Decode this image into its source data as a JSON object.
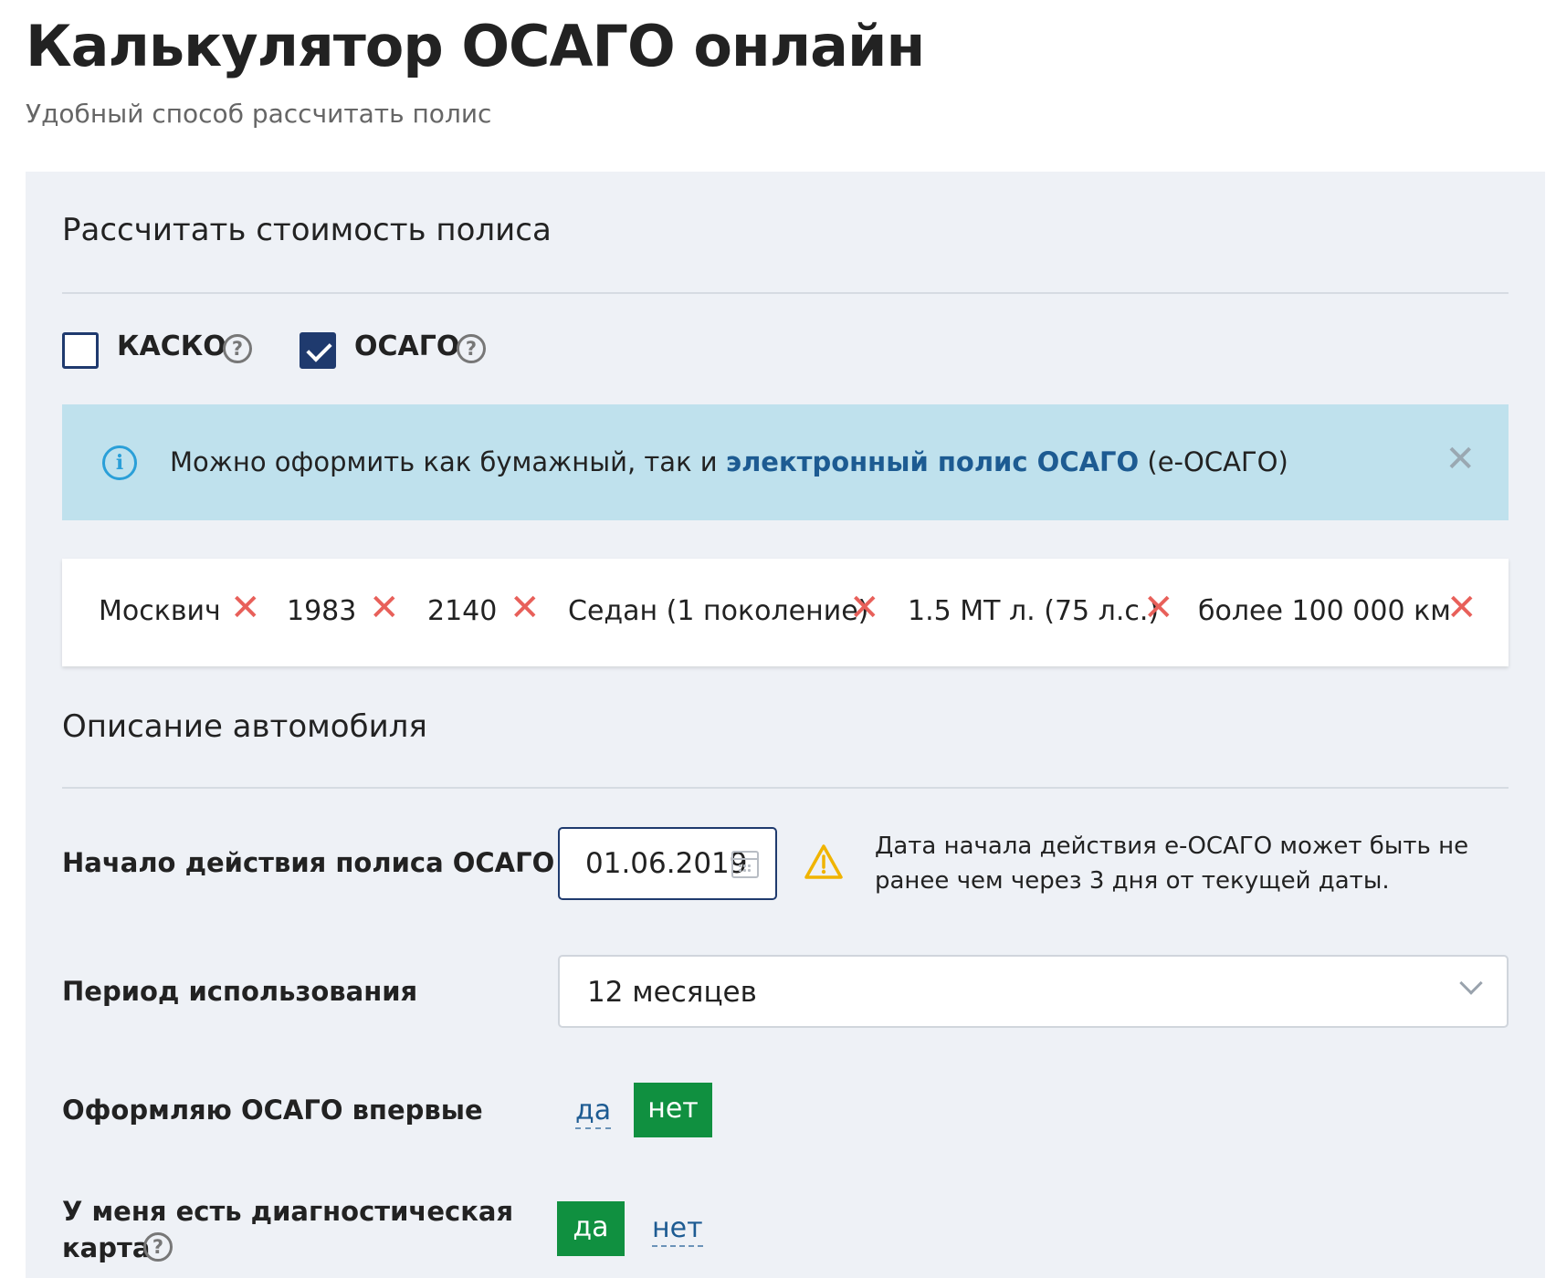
{
  "page": {
    "title": "Калькулятор ОСАГО онлайн",
    "subtitle": "Удобный способ рассчитать полис"
  },
  "calc": {
    "section_title": "Рассчитать стоимость полиса",
    "kasko": {
      "label": "КАСКО",
      "checked": false
    },
    "osago": {
      "label": "ОСАГО",
      "checked": true
    },
    "help_glyph": "?"
  },
  "banner": {
    "info_glyph": "i",
    "text_before": "Можно оформить как бумажный, так и ",
    "link_text": "электронный полис ОСАГО",
    "text_after": " (е-ОСАГО)",
    "close_glyph": "✕"
  },
  "chips": [
    {
      "label": "Москвич"
    },
    {
      "label": "1983"
    },
    {
      "label": "2140"
    },
    {
      "label": "Седан (1 поколение)"
    },
    {
      "label": "1.5 MT л. (75 л.с.)"
    },
    {
      "label": "более 100 000 км"
    }
  ],
  "chip_remove_glyph": "✕",
  "car": {
    "section_title": "Описание автомобиля",
    "start_date": {
      "label": "Начало действия полиса ОСАГО",
      "value": "01.06.2019",
      "warning": "Дата начала действия е-ОСАГО может быть не ранее чем через 3 дня от текущей даты."
    },
    "period": {
      "label": "Период использования",
      "value": "12 месяцев"
    },
    "first_time": {
      "label": "Оформляю ОСАГО впервые",
      "yes": "да",
      "no": "нет",
      "selected": "нет"
    },
    "diag_card": {
      "label_line1": "У меня есть диагностическая",
      "label_line2": "карта",
      "yes": "да",
      "no": "нет",
      "selected": "да"
    }
  },
  "colors": {
    "accent_dark": "#1f3a6e",
    "link": "#1d5b92",
    "success": "#109040",
    "banner_bg": "#bfe1ed",
    "panel_bg": "#eef1f6",
    "remove": "#e8605a",
    "warning": "#f0b400"
  },
  "icons": {
    "info": "info-circle-icon",
    "warning": "warning-triangle-icon",
    "calendar": "calendar-icon",
    "chevron": "chevron-down-icon",
    "help": "question-circle-icon",
    "close": "close-icon"
  }
}
